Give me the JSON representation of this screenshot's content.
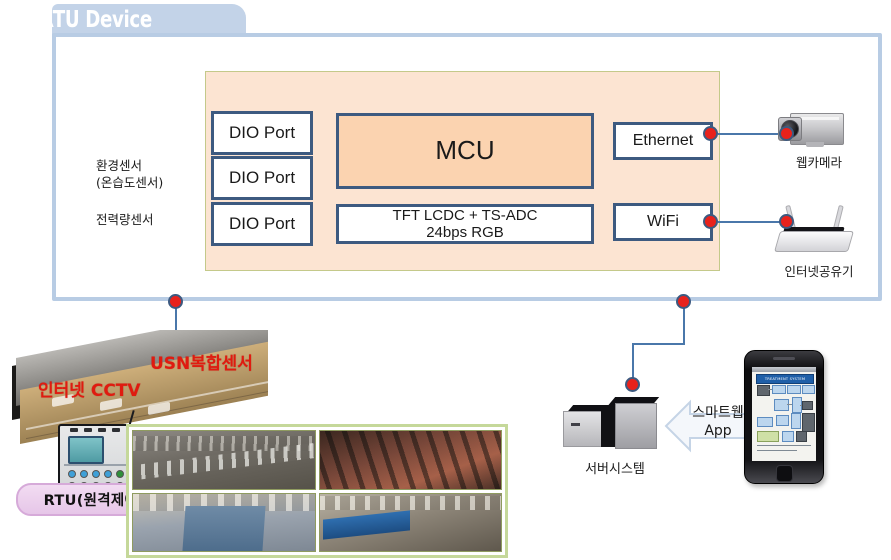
{
  "diagram": {
    "title": "RTU Device",
    "frame": {
      "border_color": "#b8cce4",
      "tab_color": "#c3d3e8"
    }
  },
  "board": {
    "panel_fill": "#fce4d2",
    "panel_border": "#c4c98a",
    "block_border": "#3d5a80",
    "mcu_fill": "#fbd3b0",
    "dio_ports": [
      {
        "label": "DIO Port"
      },
      {
        "label": "DIO Port"
      },
      {
        "label": "DIO Port"
      }
    ],
    "mcu": {
      "label": "MCU"
    },
    "display": {
      "line1": "TFT LCDC + TS-ADC",
      "line2": "24bps RGB"
    },
    "network": [
      {
        "label": "Ethernet",
        "node": "red-dot"
      },
      {
        "label": "WiFi",
        "node": "red-dot"
      }
    ]
  },
  "left_labels": {
    "environment_sensor": "환경센서\n(온습도센서)",
    "power_sensor": "전력량센서"
  },
  "peripherals": {
    "webcam": {
      "label": "웹카메라",
      "icon": "webcam-icon"
    },
    "router": {
      "label": "인터넷공유기",
      "icon": "wireless-router-icon"
    }
  },
  "field": {
    "usn_sensor_label": "USN복합센서",
    "cctv_label": "인터넷 CCTV",
    "rtu_pill_label": "RTU(원격제어장치)",
    "label_color": "#e01b10",
    "photos": [
      {
        "caption": "pig-barn-pens-photo"
      },
      {
        "caption": "pig-closeup-photo"
      },
      {
        "caption": "barn-aisle-photo"
      },
      {
        "caption": "barn-equipment-photo"
      }
    ]
  },
  "backend": {
    "server": {
      "label": "서버시스템",
      "icon": "server-rack-icon"
    },
    "link": {
      "line1": "스마트웹",
      "line2": "App",
      "icon": "double-arrow-icon"
    },
    "phone": {
      "icon": "smartphone-icon",
      "screen_title": "TREATMENT SYSTEM"
    }
  },
  "connectors": {
    "node_color": "#e8221c",
    "node_ring": "#3d5a80",
    "wire_color": "#4a77aa",
    "nodes": [
      {
        "name": "ethernet-node"
      },
      {
        "name": "wifi-node"
      },
      {
        "name": "webcam-node"
      },
      {
        "name": "router-node"
      },
      {
        "name": "usn-frame-node"
      },
      {
        "name": "server-frame-node"
      },
      {
        "name": "server-node"
      }
    ]
  }
}
